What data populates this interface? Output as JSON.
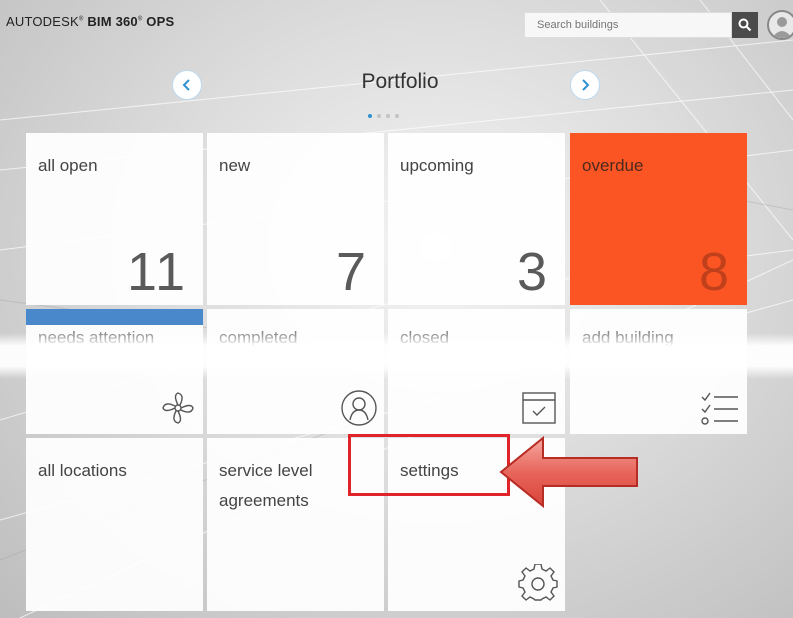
{
  "header": {
    "brand_prefix": "AUTODESK",
    "brand_name": "BIM 360",
    "brand_suffix": "OPS",
    "search_placeholder": "Search buildings"
  },
  "nav": {
    "title": "Portfolio",
    "pages": 4,
    "active_page": 1
  },
  "tiles": {
    "all_open": {
      "label": "all open",
      "count": "11"
    },
    "new": {
      "label": "new",
      "count": "7"
    },
    "upcoming": {
      "label": "upcoming",
      "count": "3"
    },
    "overdue": {
      "label": "overdue",
      "count": "8"
    },
    "needs_attention": {
      "label": "needs attention"
    },
    "completed": {
      "label": "completed"
    },
    "closed": {
      "label": "closed"
    },
    "add_building": {
      "label": "add building"
    },
    "all_locations": {
      "label": "all locations"
    },
    "sla": {
      "label_line1": "service level",
      "label_line2": "agreements"
    },
    "settings": {
      "label": "settings"
    }
  },
  "colors": {
    "overdue": "#fb5524",
    "accent_blue": "#4a88cc",
    "annotation_red": "#e1242a"
  },
  "icons": {
    "search": "magnifier-icon",
    "avatar": "user-avatar-icon",
    "prev": "chevron-left-icon",
    "next": "chevron-right-icon",
    "needs_attention": "fan-icon",
    "completed": "user-circle-icon",
    "closed": "calendar-check-icon",
    "add_building": "checklist-icon",
    "settings": "gear-icon"
  }
}
